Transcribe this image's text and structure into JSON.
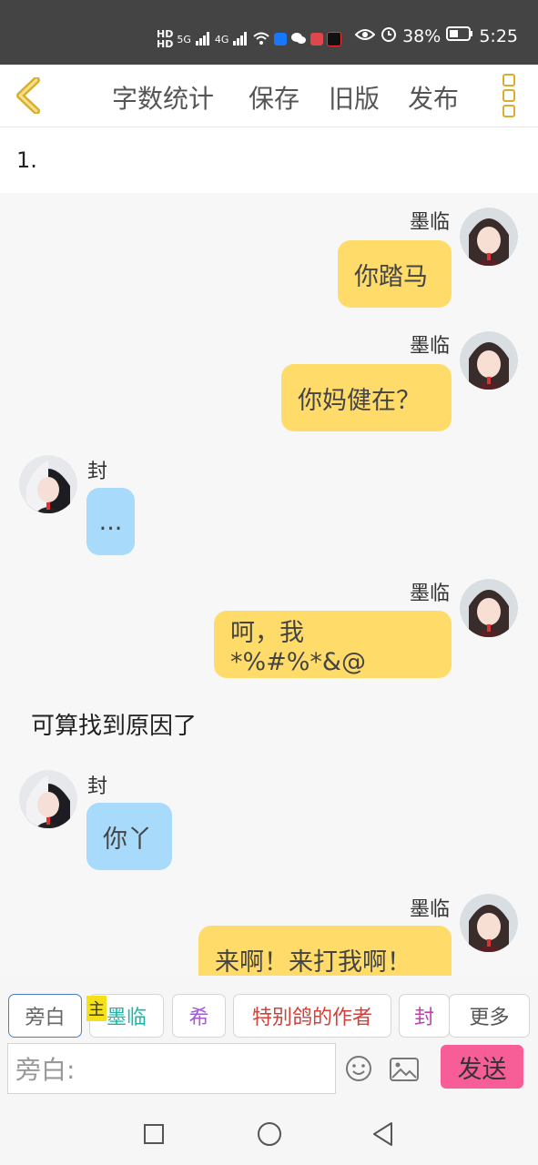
{
  "status_bar": {
    "hd1": "HD",
    "hd2": "HD",
    "net1": "5G",
    "net2": "4G",
    "battery": "38%",
    "time": "5:25"
  },
  "toolbar": {
    "word_count": "字数统计",
    "save": "保存",
    "old_version": "旧版",
    "publish": "发布"
  },
  "chapter": "1.",
  "messages": [
    {
      "side": "right",
      "name": "墨临",
      "text": "你踏马"
    },
    {
      "side": "right",
      "name": "墨临",
      "text": "你妈健在？"
    },
    {
      "side": "left",
      "name": "封",
      "text": "..."
    },
    {
      "side": "right",
      "name": "墨临",
      "text": "呵，我*%#%*&@"
    },
    {
      "side": "narration",
      "text": "可算找到原因了"
    },
    {
      "side": "left",
      "name": "封",
      "text": "你丫"
    },
    {
      "side": "right",
      "name": "墨临",
      "text": "来啊！来打我啊！"
    }
  ],
  "roles": {
    "narration": "旁白",
    "host_badge": "主",
    "molin": "墨临",
    "xi": "希",
    "author": "特别鸽的作者",
    "feng": "封",
    "more": "更多",
    "colors": {
      "molin": "#1fb5a6",
      "xi": "#a15ad6",
      "author": "#d2413a",
      "feng": "#c23fb2"
    }
  },
  "composer": {
    "placeholder": "旁白:",
    "send": "发送"
  }
}
